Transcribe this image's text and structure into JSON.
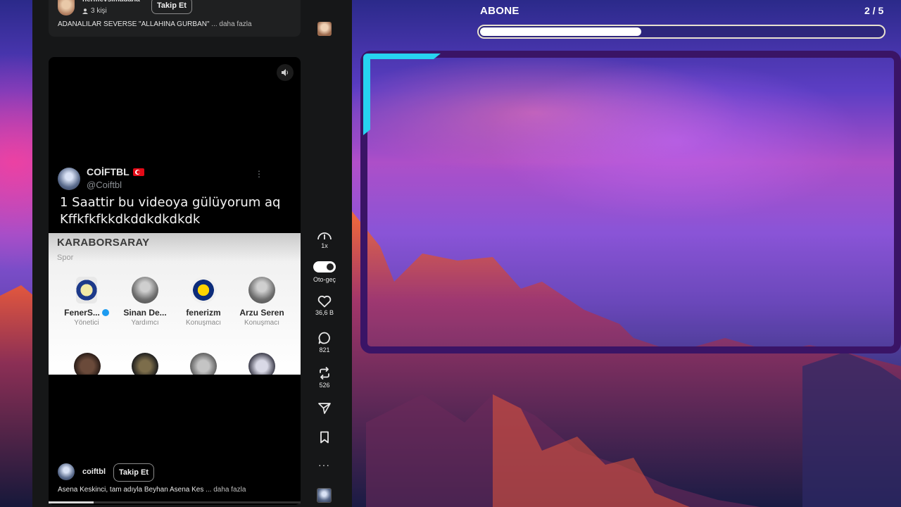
{
  "feed": {
    "previous_post": {
      "username": "hermevsimadana",
      "members": "3 kişi",
      "follow_label": "Takip Et",
      "caption": "ADANALILAR SEVERSE \"ALLAHINA GURBAN\"",
      "more_label": "... daha fazla"
    },
    "current_post": {
      "tweet": {
        "display_name": "COİFTBL",
        "handle": "@Coiftbl",
        "text": "1 Saattir bu videoya gülüyorum aq Kffkfkfkkdkddkdkdkdk"
      },
      "group": {
        "title": "KARABORSARAY",
        "subtitle": "Spor",
        "members": [
          {
            "name": "FenerS...",
            "role": "Yönetici"
          },
          {
            "name": "Sinan De...",
            "role": "Yardımcı"
          },
          {
            "name": "fenerizm",
            "role": "Konuşmacı"
          },
          {
            "name": "Arzu Seren",
            "role": "Konuşmacı"
          }
        ]
      },
      "owner_username": "coiftbl",
      "follow_label": "Takip Et",
      "caption": "Asena Keskinci, tam adıyla Beyhan Asena Kes",
      "more_label": "... daha fazla",
      "progress": 0.18
    }
  },
  "rail": {
    "speed_label": "1x",
    "autoplay_label": "Oto-geç",
    "autoplay_on": true,
    "likes": "36,6 B",
    "comments": "821",
    "reposts": "526",
    "icons": [
      "speed-icon",
      "toggle-switch",
      "heart-icon",
      "comment-icon",
      "repost-icon",
      "send-icon",
      "bookmark-icon",
      "more-icon"
    ]
  },
  "overlay": {
    "goal_label": "ABONE",
    "goal_count": "2 / 5",
    "goal_progress": 0.4,
    "frame_accent": "#27d3f0",
    "frame_color": "#3a1466"
  }
}
